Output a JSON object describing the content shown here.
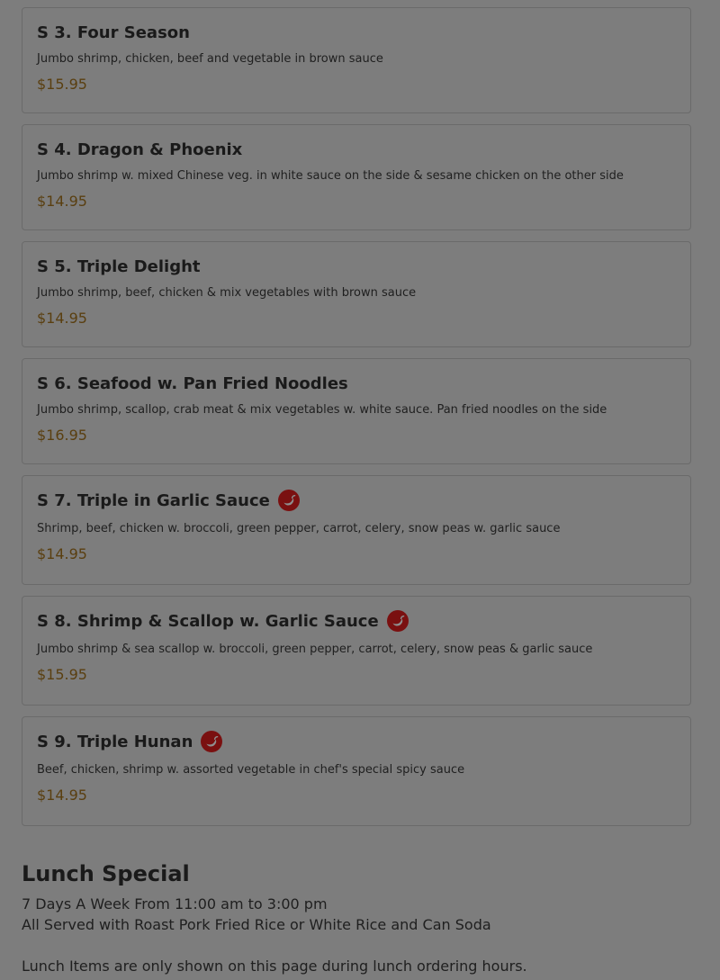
{
  "items": [
    {
      "title": "S 3. Four Season",
      "description": "Jumbo shrimp, chicken, beef and vegetable in brown sauce",
      "price": "$15.95",
      "spicy": false
    },
    {
      "title": "S 4. Dragon & Phoenix",
      "description": "Jumbo shrimp w. mixed Chinese veg. in white sauce on the side & sesame chicken on the other side",
      "price": "$14.95",
      "spicy": false
    },
    {
      "title": "S 5. Triple Delight",
      "description": "Jumbo shrimp, beef, chicken & mix vegetables with brown sauce",
      "price": "$14.95",
      "spicy": false
    },
    {
      "title": "S 6. Seafood w. Pan Fried Noodles",
      "description": "Jumbo shrimp, scallop, crab meat & mix vegetables w. white sauce. Pan fried noodles on the side",
      "price": "$16.95",
      "spicy": false
    },
    {
      "title": "S 7. Triple in Garlic Sauce",
      "description": "Shrimp, beef, chicken w. broccoli, green pepper, carrot, celery, snow peas w. garlic sauce",
      "price": "$14.95",
      "spicy": true
    },
    {
      "title": "S 8. Shrimp & Scallop w. Garlic Sauce",
      "description": "Jumbo shrimp & sea scallop w. broccoli, green pepper, carrot, celery, snow peas & garlic sauce",
      "price": "$15.95",
      "spicy": true
    },
    {
      "title": "S 9. Triple Hunan",
      "description": "Beef, chicken, shrimp w. assorted vegetable in chef's special spicy sauce",
      "price": "$14.95",
      "spicy": true
    }
  ],
  "lunch": {
    "title": "Lunch Special",
    "hours": "7 Days A Week From 11:00 am to 3:00 pm",
    "served_with": "All Served with Roast Pork Fried Rice or White Rice and Can Soda",
    "note": "Lunch Items are only shown on this page during lunch ordering hours."
  },
  "colors": {
    "overlay_background": "#7d7d7d",
    "price": "#5a3f10",
    "spicy_badge": "#7a1010"
  },
  "icons": {
    "spicy": "chili-pepper-icon"
  }
}
